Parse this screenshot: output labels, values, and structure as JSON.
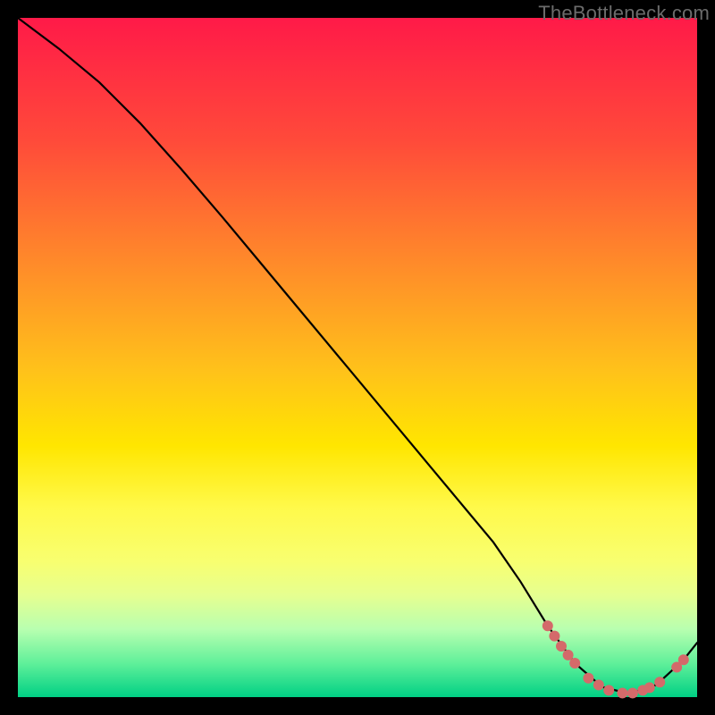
{
  "watermark": "TheBottleneck.com",
  "chart_data": {
    "type": "line",
    "title": "",
    "xlabel": "",
    "ylabel": "",
    "xlim": [
      0,
      100
    ],
    "ylim": [
      0,
      100
    ],
    "series": [
      {
        "name": "bottleneck-curve",
        "x": [
          0,
          6,
          12,
          18,
          24,
          30,
          36,
          42,
          48,
          54,
          60,
          66,
          70,
          74,
          78,
          82,
          86,
          90,
          94,
          98,
          100
        ],
        "y": [
          100,
          95.5,
          90.5,
          84.5,
          77.8,
          70.8,
          63.6,
          56.4,
          49.2,
          42.0,
          34.8,
          27.6,
          22.8,
          17.0,
          10.5,
          5.0,
          1.5,
          0.5,
          1.8,
          5.5,
          8.0
        ]
      }
    ],
    "highlight_points": {
      "name": "dotted-highlight",
      "color": "#d46a6a",
      "points": [
        {
          "x": 78,
          "y": 10.5
        },
        {
          "x": 79,
          "y": 9.0
        },
        {
          "x": 80,
          "y": 7.5
        },
        {
          "x": 81,
          "y": 6.2
        },
        {
          "x": 82,
          "y": 5.0
        },
        {
          "x": 84,
          "y": 2.8
        },
        {
          "x": 85.5,
          "y": 1.8
        },
        {
          "x": 87,
          "y": 1.0
        },
        {
          "x": 89,
          "y": 0.6
        },
        {
          "x": 90.5,
          "y": 0.6
        },
        {
          "x": 92,
          "y": 1.0
        },
        {
          "x": 93,
          "y": 1.4
        },
        {
          "x": 94.5,
          "y": 2.2
        },
        {
          "x": 97,
          "y": 4.4
        },
        {
          "x": 98,
          "y": 5.5
        }
      ]
    }
  }
}
